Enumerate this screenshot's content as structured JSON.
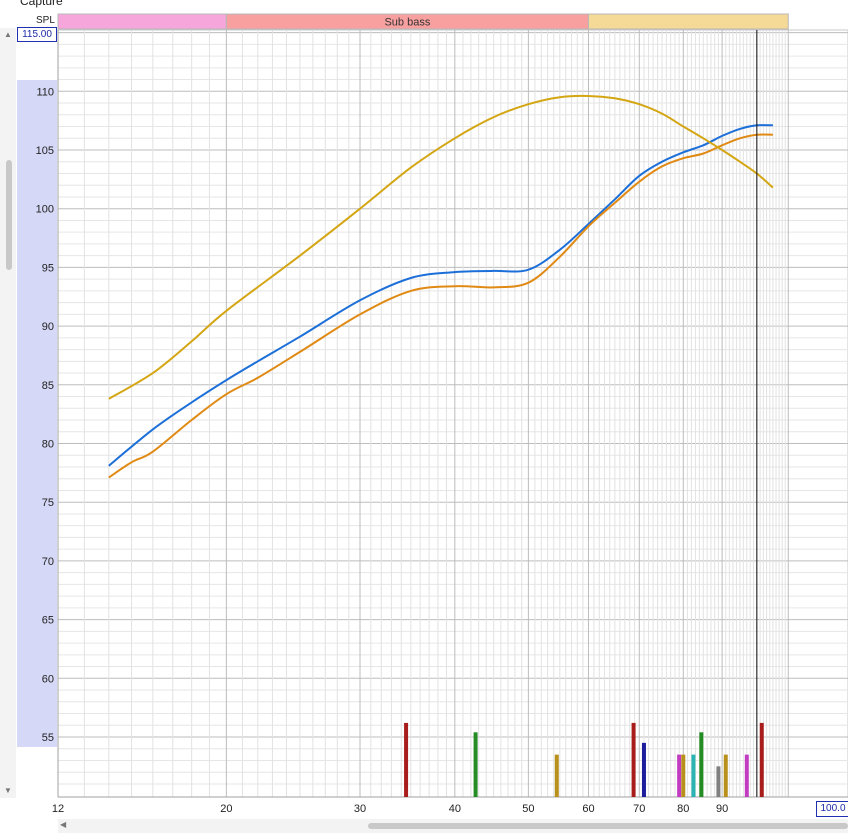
{
  "window": {
    "caption": "Capture"
  },
  "chart_data": {
    "type": "line",
    "ylabel": "SPL",
    "xscale": "log",
    "xlim": [
      12,
      100
    ],
    "ylim": [
      51,
      115
    ],
    "y_max_readout": "115.00",
    "x_cursor_readout": "100.0",
    "x_cursor": 100,
    "x_ticks": [
      12,
      20,
      30,
      40,
      50,
      60,
      70,
      80,
      90
    ],
    "y_ticks": [
      55,
      60,
      65,
      70,
      75,
      80,
      85,
      90,
      95,
      100,
      105,
      110
    ],
    "range_band": [
      54.2,
      109.2
    ],
    "bands": [
      {
        "label": "",
        "from": 12,
        "to": 20,
        "color": "#f7a6dc"
      },
      {
        "label": "Sub bass",
        "from": 20,
        "to": 60,
        "color": "#f8a0a0"
      },
      {
        "label": "",
        "from": 60,
        "to": 110,
        "color": "#f5d996"
      }
    ],
    "series": [
      {
        "color": "#1c6fd8",
        "x": [
          14,
          16,
          18,
          20,
          22,
          25,
          30,
          35,
          40,
          45,
          50,
          55,
          60,
          65,
          70,
          75,
          80,
          85,
          90,
          95,
          100,
          105
        ],
        "y": [
          78.1,
          81.2,
          83.5,
          85.4,
          87.0,
          89.1,
          92.2,
          94.1,
          94.6,
          94.7,
          94.8,
          96.5,
          98.7,
          100.8,
          102.8,
          104.0,
          104.8,
          105.4,
          106.2,
          106.8,
          107.1,
          107.1
        ]
      },
      {
        "color": "#e08a14",
        "x": [
          14,
          15,
          16,
          18,
          20,
          22,
          25,
          30,
          35,
          40,
          45,
          50,
          55,
          60,
          65,
          70,
          75,
          80,
          85,
          90,
          95,
          100,
          105
        ],
        "y": [
          77.1,
          78.4,
          79.3,
          82.0,
          84.2,
          85.6,
          87.8,
          91.0,
          93.0,
          93.4,
          93.3,
          93.7,
          95.9,
          98.5,
          100.5,
          102.3,
          103.6,
          104.3,
          104.7,
          105.4,
          106.0,
          106.3,
          106.3
        ]
      },
      {
        "color": "#d4a614",
        "x": [
          14,
          16,
          18,
          20,
          25,
          30,
          35,
          40,
          45,
          50,
          55,
          60,
          65,
          70,
          75,
          80,
          85,
          90,
          95,
          100,
          105
        ],
        "y": [
          83.8,
          86.0,
          88.7,
          91.3,
          96.0,
          100.0,
          103.5,
          106.0,
          107.8,
          108.9,
          109.5,
          109.6,
          109.4,
          108.9,
          108.1,
          107.0,
          106.0,
          105.0,
          104.0,
          103.0,
          101.8
        ]
      }
    ],
    "markers": [
      {
        "x": 34.5,
        "top": 56.2,
        "color": "#a81c1c"
      },
      {
        "x": 42.6,
        "top": 55.4,
        "color": "#238c23"
      },
      {
        "x": 54.5,
        "top": 53.5,
        "color": "#b8901c"
      },
      {
        "x": 68.8,
        "top": 56.2,
        "color": "#a81c1c"
      },
      {
        "x": 71.0,
        "top": 54.5,
        "color": "#1e1e9c"
      },
      {
        "x": 79.0,
        "top": 53.5,
        "color": "#c23cc2"
      },
      {
        "x": 80.0,
        "top": 53.5,
        "color": "#b8901c"
      },
      {
        "x": 82.5,
        "top": 53.5,
        "color": "#2cb4b4"
      },
      {
        "x": 84.5,
        "top": 55.4,
        "color": "#238c23"
      },
      {
        "x": 89.0,
        "top": 52.5,
        "color": "#808080"
      },
      {
        "x": 91.0,
        "top": 53.5,
        "color": "#b8901c"
      },
      {
        "x": 97.0,
        "top": 53.5,
        "color": "#c23cc2"
      },
      {
        "x": 101.5,
        "top": 56.2,
        "color": "#a81c1c"
      }
    ]
  }
}
